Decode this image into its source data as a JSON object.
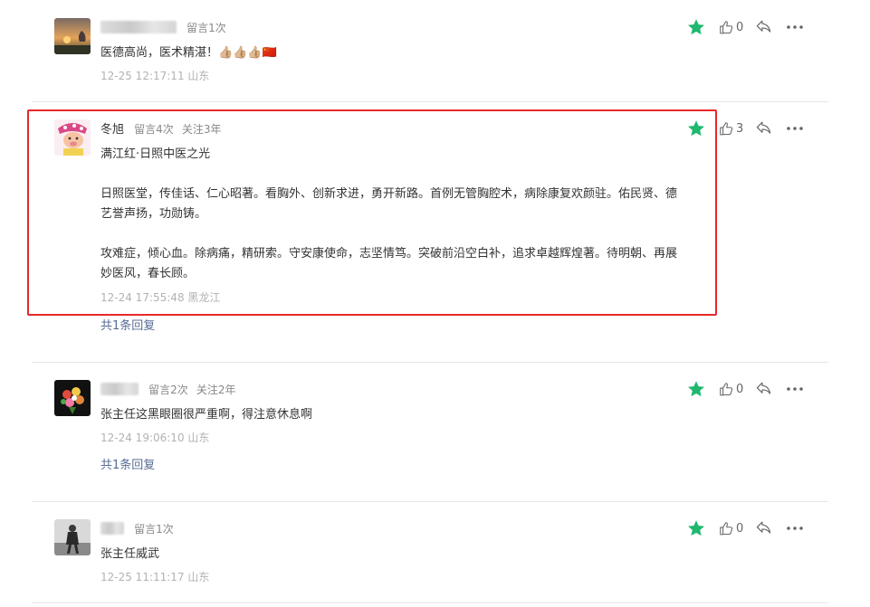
{
  "colors": {
    "star": "#1fb86e",
    "highlight_border": "#e8282a",
    "link": "#576b95",
    "time": "#b2b2b2"
  },
  "comments": [
    {
      "name": "",
      "badge1": "留言1次",
      "badge2": "",
      "paragraphs": [
        "医德高尚，医术精湛！👍🏼👍🏼👍🏼🇨🇳"
      ],
      "time": "12-25 12:17:11 山东",
      "likes": "0",
      "replies": ""
    },
    {
      "name": "冬旭",
      "badge1": "留言4次",
      "badge2": "关注3年",
      "paragraphs": [
        "满江红·日照中医之光",
        "日照医堂，传佳话、仁心昭著。看胸外、创新求进，勇开新路。首例无管胸腔术，病除康复欢颜驻。佑民贤、德艺誉声扬，功勋铸。",
        "攻难症，倾心血。除病痛，精研索。守安康使命，志坚情笃。突破前沿空白补，追求卓越辉煌著。待明朝、再展妙医风，春长顾。"
      ],
      "time": "12-24 17:55:48 黑龙江",
      "likes": "3",
      "replies": "共1条回复"
    },
    {
      "name": "",
      "badge1": "留言2次",
      "badge2": "关注2年",
      "paragraphs": [
        "张主任这黑眼圈很严重啊，得注意休息啊"
      ],
      "time": "12-24 19:06:10 山东",
      "likes": "0",
      "replies": "共1条回复"
    },
    {
      "name": "",
      "badge1": "留言1次",
      "badge2": "",
      "paragraphs": [
        "张主任威武"
      ],
      "time": "12-25 11:11:17 山东",
      "likes": "0",
      "replies": ""
    }
  ],
  "icons": {
    "star": "star-icon",
    "like": "thumbs-up-icon",
    "reply": "reply-arrow-icon",
    "more": "more-dots-icon"
  }
}
